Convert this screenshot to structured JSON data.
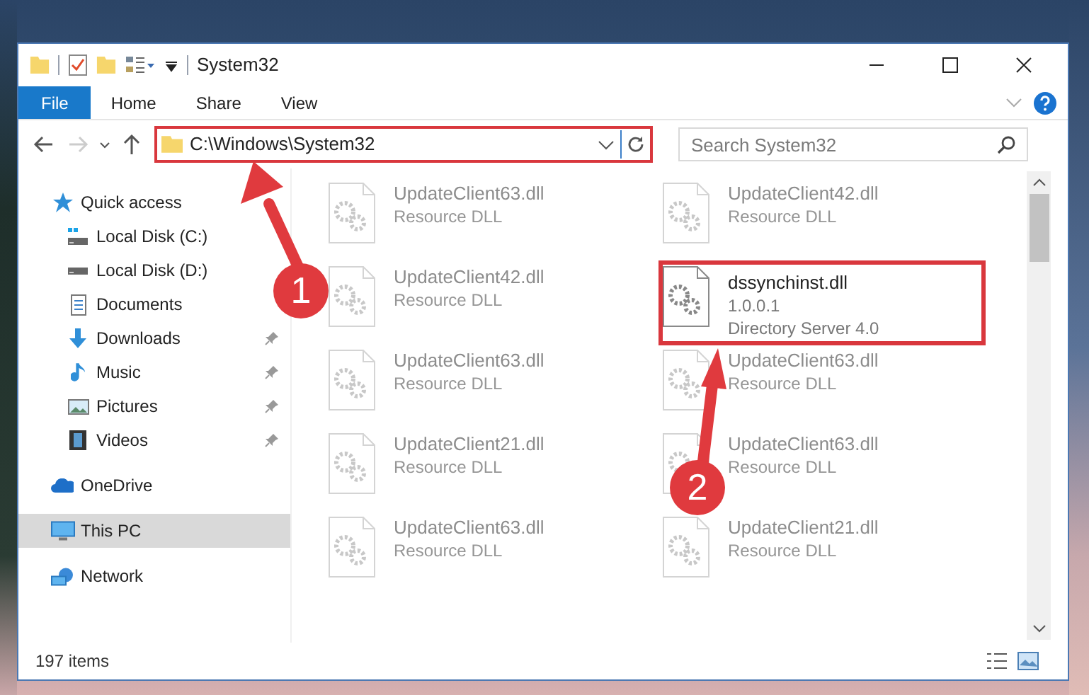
{
  "window": {
    "title": "System32"
  },
  "ribbon_tabs": [
    {
      "label": "File",
      "selected": true
    },
    {
      "label": "Home",
      "selected": false
    },
    {
      "label": "Share",
      "selected": false
    },
    {
      "label": "View",
      "selected": false
    }
  ],
  "address": {
    "value": "C:\\Windows\\System32"
  },
  "search": {
    "placeholder": "Search System32"
  },
  "sidebar": {
    "items": [
      {
        "label": "Quick access",
        "kind": "star",
        "selected": false,
        "children": [
          {
            "label": "Local Disk (C:)",
            "kind": "drive-c",
            "pinned": false,
            "selected": false
          },
          {
            "label": "Local Disk (D:)",
            "kind": "drive",
            "pinned": false,
            "selected": false
          },
          {
            "label": "Documents",
            "kind": "docs",
            "pinned": false,
            "selected": false
          },
          {
            "label": "Downloads",
            "kind": "downloads",
            "pinned": true,
            "selected": false
          },
          {
            "label": "Music",
            "kind": "music",
            "pinned": true,
            "selected": false
          },
          {
            "label": "Pictures",
            "kind": "pictures",
            "pinned": true,
            "selected": false
          },
          {
            "label": "Videos",
            "kind": "videos",
            "pinned": true,
            "selected": false
          }
        ]
      },
      {
        "label": "OneDrive",
        "kind": "cloud",
        "selected": false
      },
      {
        "label": "This PC",
        "kind": "pc",
        "selected": true
      },
      {
        "label": "Network",
        "kind": "network",
        "selected": false
      }
    ]
  },
  "files": [
    {
      "kind": "faded",
      "name": "UpdateClient63.dll",
      "lines": [
        "Resource DLL"
      ]
    },
    {
      "kind": "faded",
      "name": "UpdateClient42.dll",
      "lines": [
        "Resource DLL"
      ]
    },
    {
      "kind": "faded",
      "name": "UpdateClient42.dll",
      "lines": [
        "Resource DLL"
      ]
    },
    {
      "kind": "clear",
      "name": "dssynchinst.dll",
      "lines": [
        "1.0.0.1",
        "Directory Server 4.0"
      ]
    },
    {
      "kind": "faded",
      "name": "UpdateClient63.dll",
      "lines": [
        "Resource DLL"
      ]
    },
    {
      "kind": "faded",
      "name": "UpdateClient63.dll",
      "lines": [
        "Resource DLL"
      ]
    },
    {
      "kind": "faded",
      "name": "UpdateClient21.dll",
      "lines": [
        "Resource DLL"
      ]
    },
    {
      "kind": "faded",
      "name": "UpdateClient63.dll",
      "lines": [
        "Resource DLL"
      ]
    },
    {
      "kind": "faded",
      "name": "UpdateClient63.dll",
      "lines": [
        "Resource DLL"
      ]
    },
    {
      "kind": "faded",
      "name": "UpdateClient21.dll",
      "lines": [
        "Resource DLL"
      ]
    }
  ],
  "status_bar": {
    "count": "197 items"
  },
  "annotations": [
    {
      "number": "1"
    },
    {
      "number": "2"
    }
  ]
}
